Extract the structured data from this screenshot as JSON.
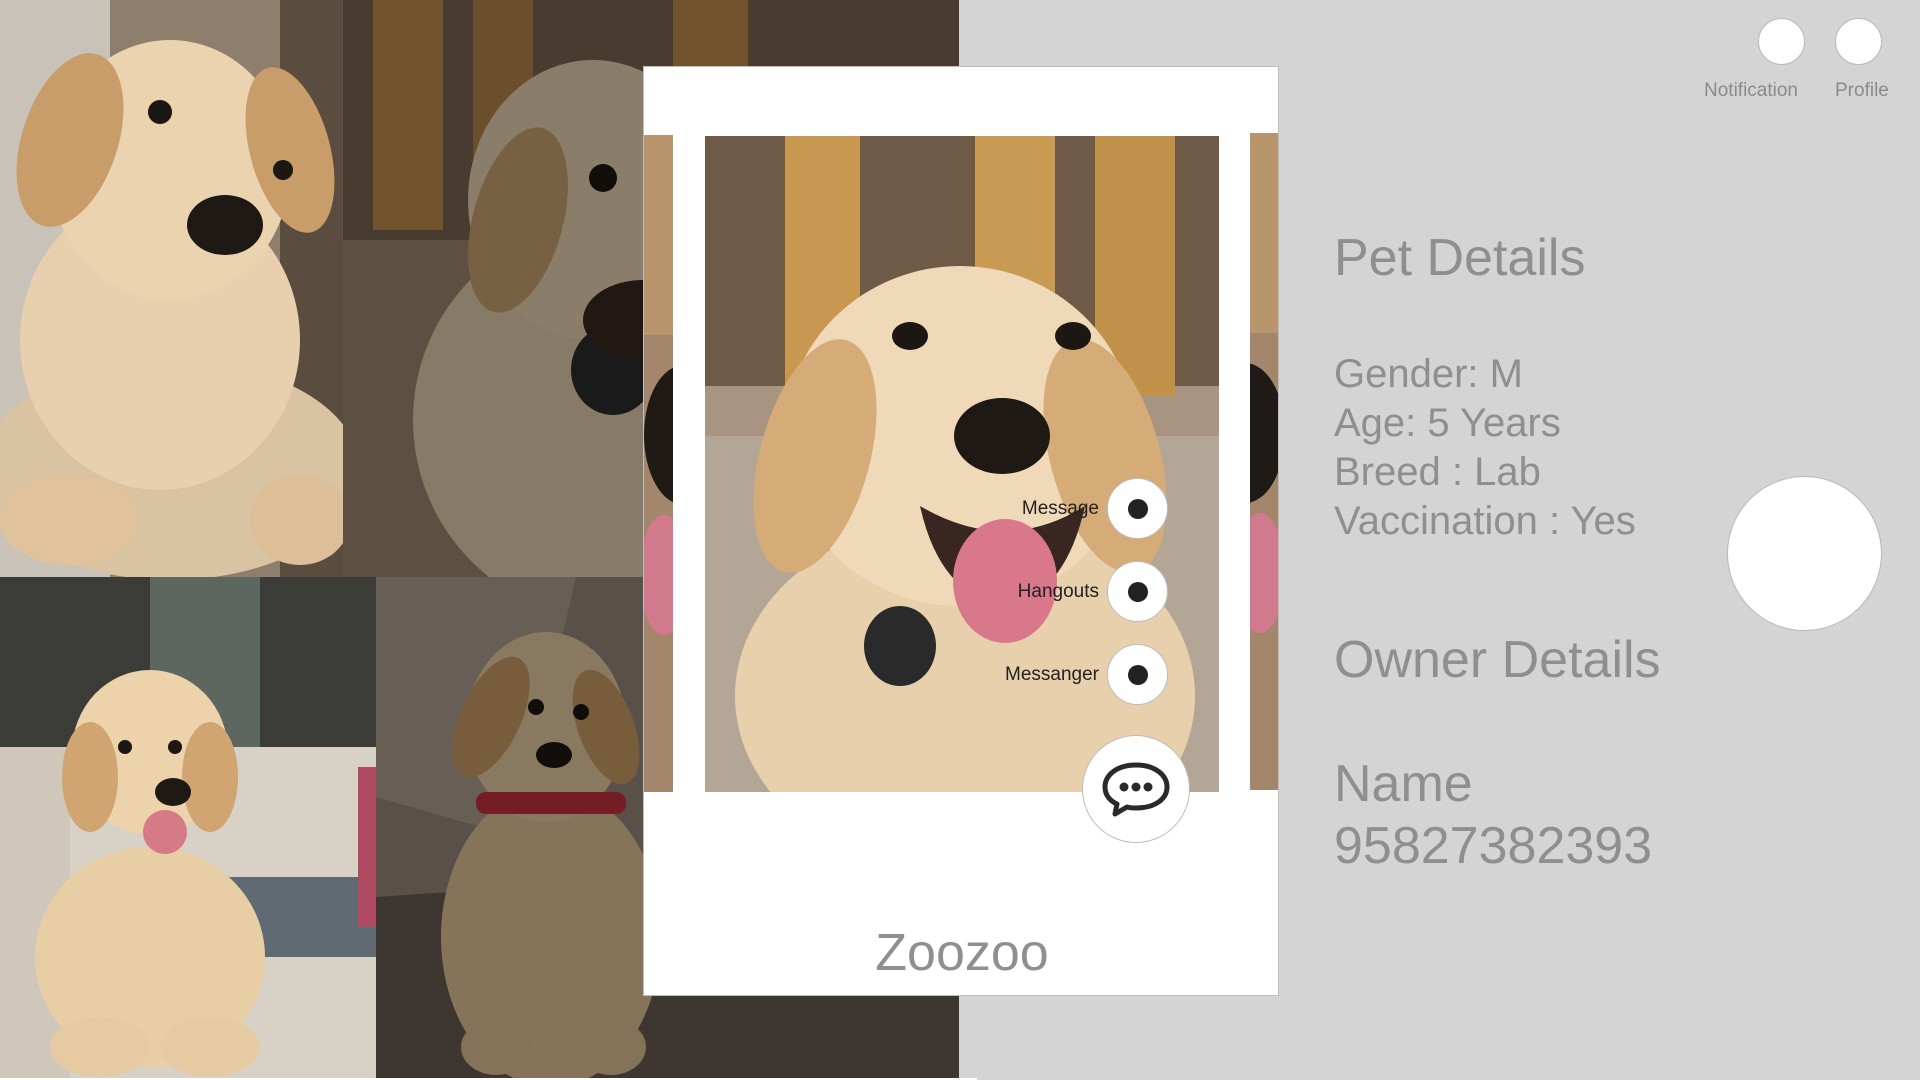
{
  "header": {
    "notification_label": "Notification",
    "profile_label": "Profile"
  },
  "pet_card": {
    "name": "Zoozoo",
    "share_options": [
      {
        "label": "Message"
      },
      {
        "label": "Hangouts"
      },
      {
        "label": "Messanger"
      }
    ]
  },
  "pet_details": {
    "title": "Pet Details",
    "gender": "Gender: M",
    "age": "Age: 5 Years",
    "breed": "Breed : Lab",
    "vaccination": "Vaccination : Yes"
  },
  "owner_details": {
    "title": "Owner Details",
    "name": "Name",
    "phone": "95827382393"
  },
  "icons": {
    "chat": "chat-bubble-icon",
    "share_dot": "dot-icon"
  },
  "colors": {
    "panel_background": "#d4d4d4",
    "text_gray": "#8f8f8f",
    "fur": "#e3c79c"
  }
}
